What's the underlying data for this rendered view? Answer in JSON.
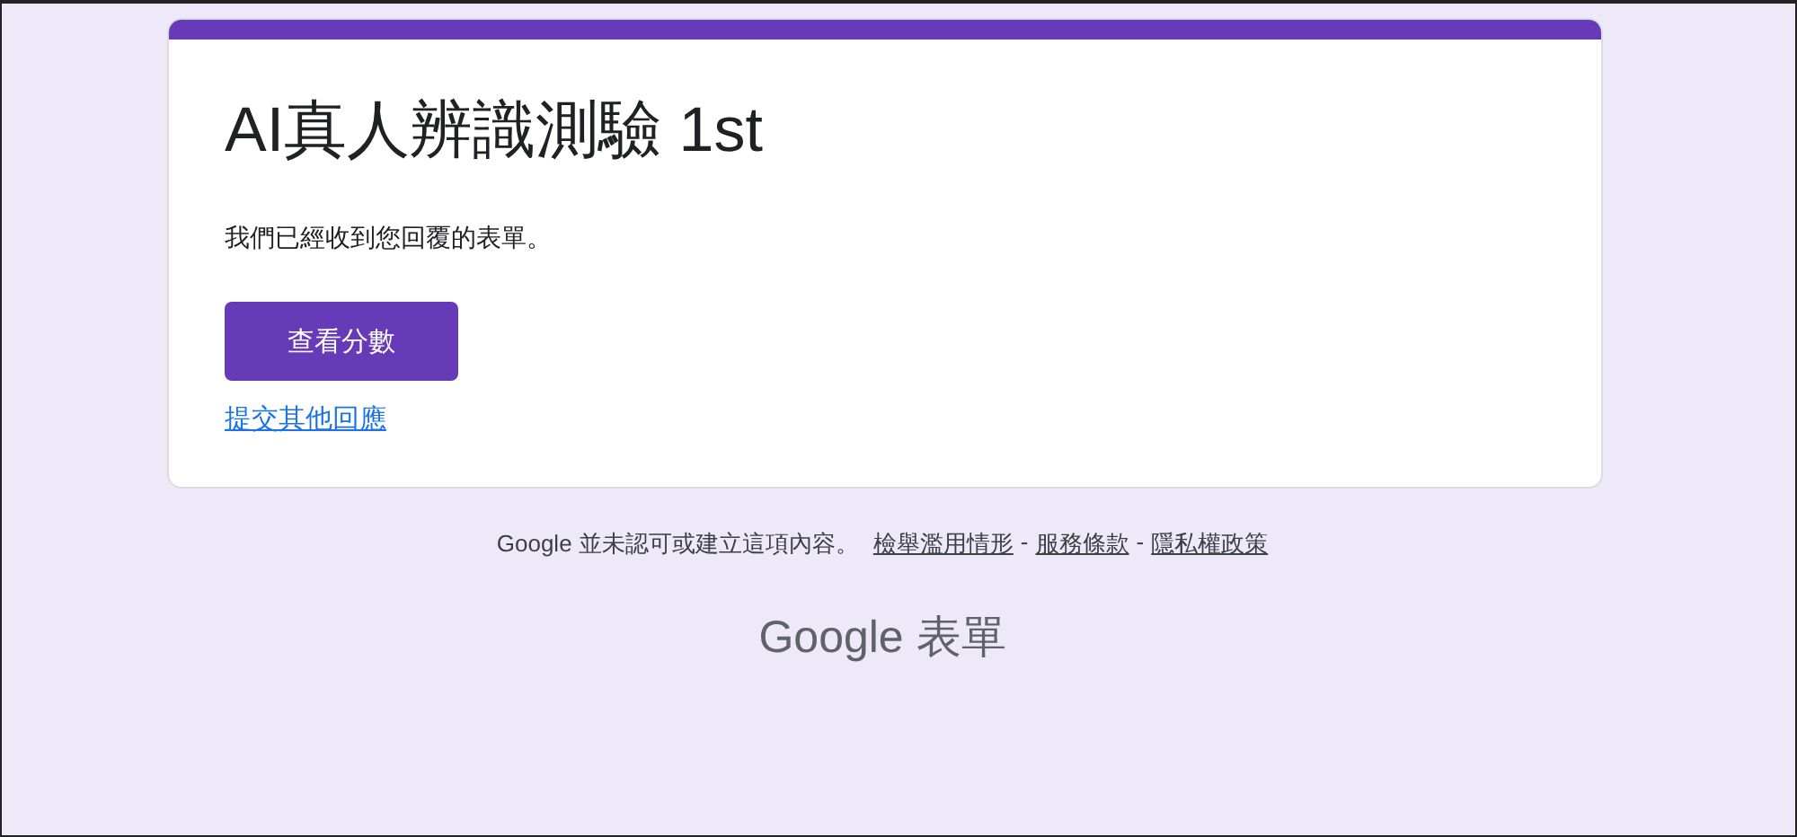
{
  "card": {
    "title": "AI真人辨識測驗 1st",
    "message": "我們已經收到您回覆的表單。",
    "button": "查看分數",
    "link": "提交其他回應"
  },
  "footer": {
    "items": [
      {
        "kind": "text",
        "text": "Google 並未認可或建立這項內容。"
      },
      {
        "kind": "link",
        "text": "檢舉濫用情形"
      },
      {
        "kind": "separator",
        "text": "-"
      },
      {
        "kind": "link",
        "text": "服務條款"
      },
      {
        "kind": "separator",
        "text": "-"
      },
      {
        "kind": "link",
        "text": "隱私權政策"
      }
    ]
  },
  "brand": "Google 表單"
}
